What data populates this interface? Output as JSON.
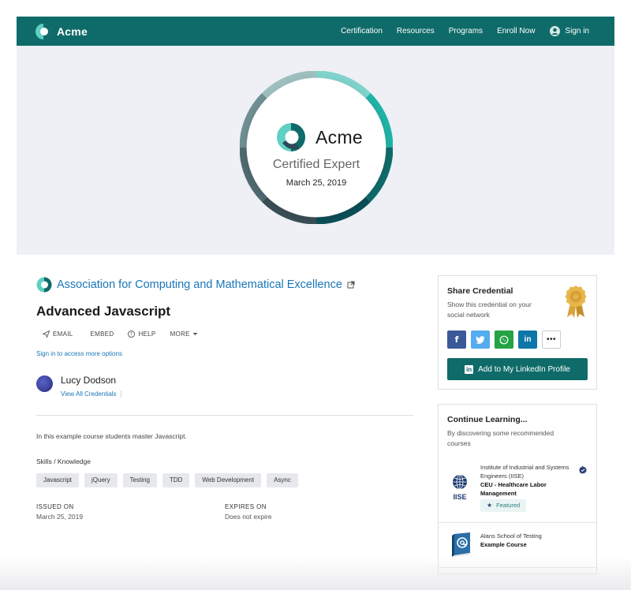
{
  "nav": {
    "brand": "Acme",
    "links": [
      "Certification",
      "Resources",
      "Programs",
      "Enroll Now"
    ],
    "signin": "Sign in"
  },
  "badge": {
    "brand": "Acme",
    "title": "Certified Expert",
    "date": "March 25, 2019"
  },
  "credential": {
    "issuer": "Association for Computing and Mathematical Excellence",
    "title": "Advanced Javascript",
    "actions": [
      "EMAIL",
      "EMBED",
      "HELP",
      "MORE"
    ],
    "signin_more": "Sign in to access more options",
    "recipient": "Lucy Dodson",
    "view_all": "View All Credentials",
    "description": "In this example course students master Javascript.",
    "skills_label": "Skills / Knowledge",
    "skills": [
      "Javascript",
      "jQuery",
      "Testing",
      "TDD",
      "Web Development",
      "Async"
    ],
    "issued_label": "ISSUED ON",
    "issued_value": "March 25, 2019",
    "expires_label": "EXPIRES ON",
    "expires_value": "Does not expire"
  },
  "share": {
    "title": "Share Credential",
    "subtitle": "Show this credential on your social network",
    "linkedin_button": "Add to My LinkedIn Profile",
    "colors": {
      "facebook": "#3b5998",
      "twitter": "#55acee",
      "whatsapp": "#25a244",
      "linkedin": "#0e76a8"
    }
  },
  "learn": {
    "title": "Continue Learning...",
    "subtitle": "By discovering some recommended courses",
    "courses": [
      {
        "org": "Institute of Industrial and Systems Engineers (IISE)",
        "name": "CEU - Healthcare Labor Management",
        "tag": "Featured",
        "logo_text": "IISE"
      },
      {
        "org": "Alans School of Testing",
        "name": "Example Course"
      }
    ]
  }
}
